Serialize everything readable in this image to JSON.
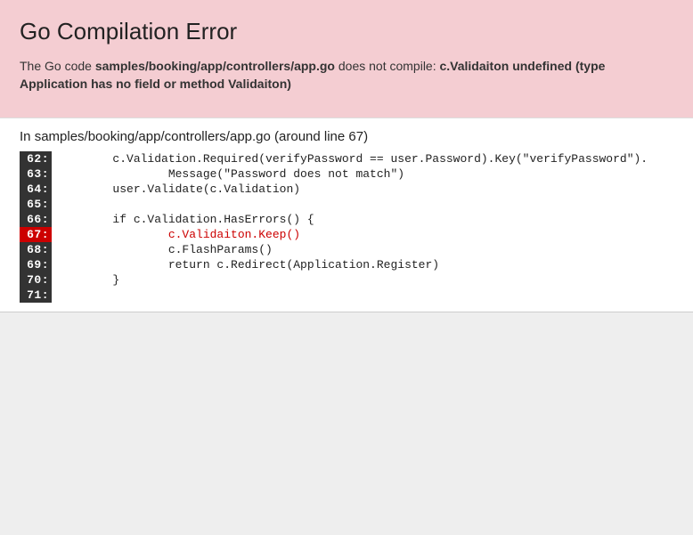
{
  "header": {
    "title": "Go Compilation Error",
    "desc_prefix": "The Go code ",
    "file_path": "samples/booking/app/controllers/app.go",
    "desc_mid": " does not compile: ",
    "error_msg": "c.Validaiton undefined (type Application has no field or method Validaiton)"
  },
  "code": {
    "heading_prefix": "In ",
    "heading_file": "samples/booking/app/controllers/app.go",
    "heading_suffix": " (around line 67)",
    "error_line": 67,
    "lines": [
      {
        "num": "62:",
        "content": "        c.Validation.Required(verifyPassword == user.Password).Key(\"verifyPassword\")."
      },
      {
        "num": "63:",
        "content": "                Message(\"Password does not match\")"
      },
      {
        "num": "64:",
        "content": "        user.Validate(c.Validation)"
      },
      {
        "num": "65:",
        "content": ""
      },
      {
        "num": "66:",
        "content": "        if c.Validation.HasErrors() {"
      },
      {
        "num": "67:",
        "content": "                c.Validaiton.Keep()"
      },
      {
        "num": "68:",
        "content": "                c.FlashParams()"
      },
      {
        "num": "69:",
        "content": "                return c.Redirect(Application.Register)"
      },
      {
        "num": "70:",
        "content": "        }"
      },
      {
        "num": "71:",
        "content": ""
      }
    ]
  }
}
